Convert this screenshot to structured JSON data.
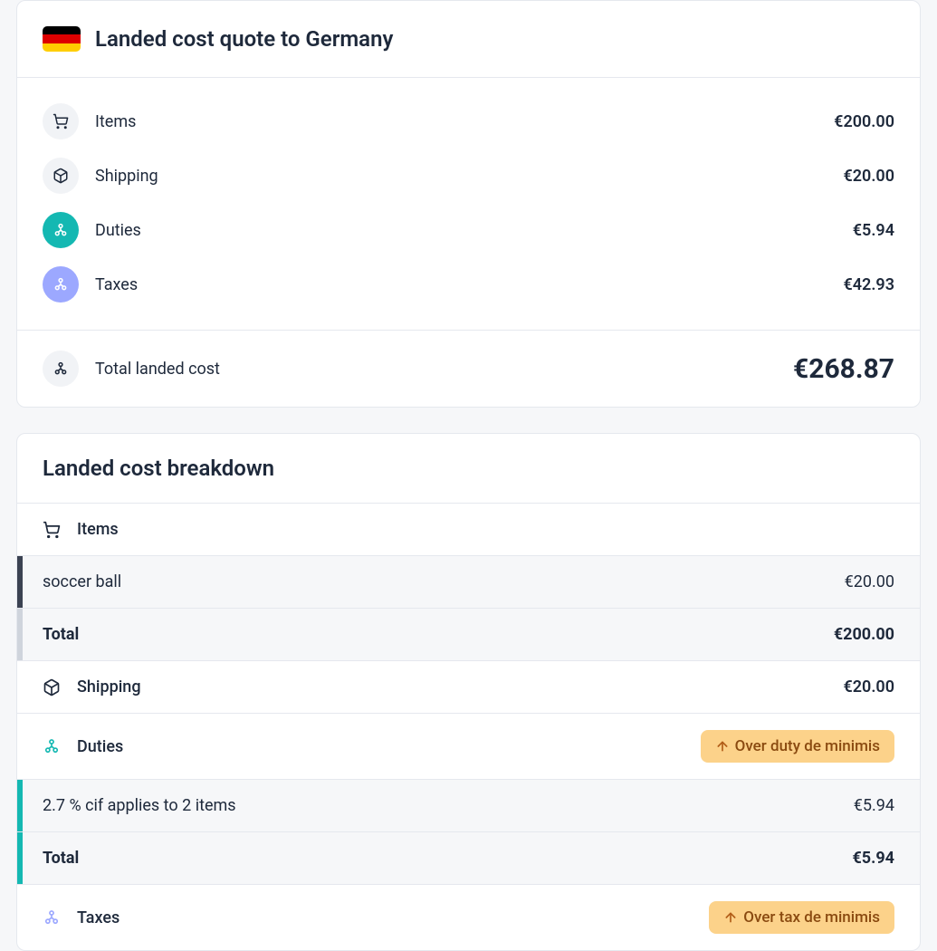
{
  "quote": {
    "title": "Landed cost quote to Germany",
    "items_label": "Items",
    "items_value": "€200.00",
    "shipping_label": "Shipping",
    "shipping_value": "€20.00",
    "duties_label": "Duties",
    "duties_value": "€5.94",
    "taxes_label": "Taxes",
    "taxes_value": "€42.93",
    "total_label": "Total landed cost",
    "total_value": "€268.87"
  },
  "breakdown": {
    "title": "Landed cost breakdown",
    "items_label": "Items",
    "item_rows": [
      {
        "label": "soccer ball",
        "value": "€20.00"
      }
    ],
    "items_total_label": "Total",
    "items_total_value": "€200.00",
    "shipping_label": "Shipping",
    "shipping_value": "€20.00",
    "duties_label": "Duties",
    "duties_badge": "Over duty de minimis",
    "duties_rows": [
      {
        "label": "2.7 % cif applies to 2 items",
        "value": "€5.94"
      }
    ],
    "duties_total_label": "Total",
    "duties_total_value": "€5.94",
    "taxes_label": "Taxes",
    "taxes_badge": "Over tax de minimis"
  }
}
